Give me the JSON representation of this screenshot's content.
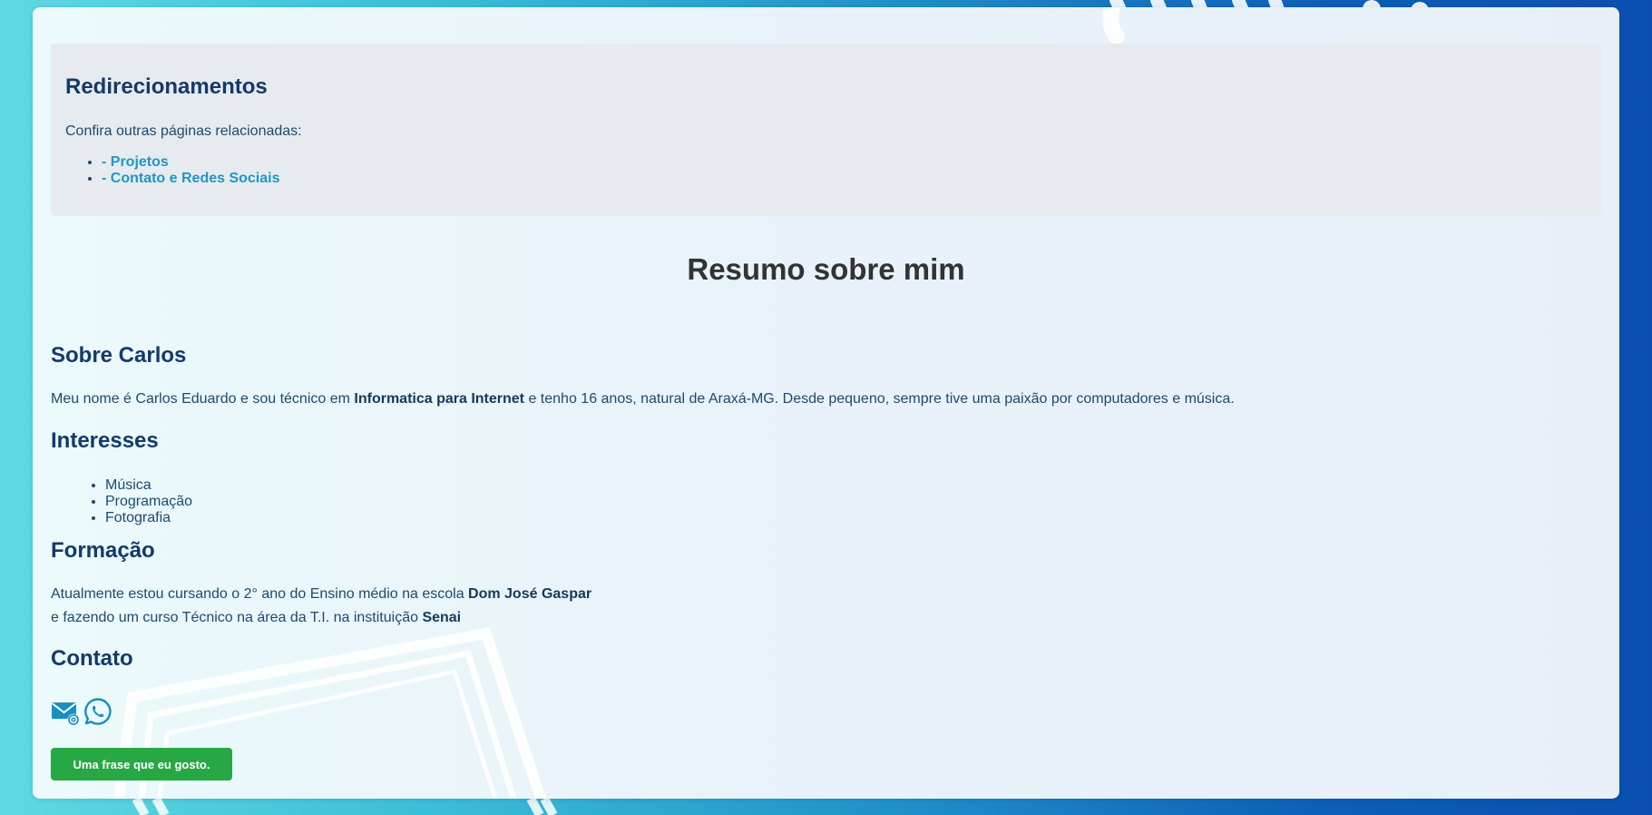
{
  "redirects": {
    "title": "Redirecionamentos",
    "intro": "Confira outras páginas relacionadas:",
    "links": [
      {
        "label": "- Projetos"
      },
      {
        "label": "- Contato e Redes Sociais"
      }
    ]
  },
  "page_title": "Resumo sobre mim",
  "about": {
    "heading": "Sobre Carlos",
    "text_before": "Meu nome é Carlos Eduardo e sou técnico em ",
    "text_bold": "Informatica para Internet",
    "text_after": " e tenho 16 anos, natural de Araxá-MG. Desde pequeno, sempre tive uma paixão por computadores e música."
  },
  "interests": {
    "heading": "Interesses",
    "items": [
      "Música",
      "Programação",
      "Fotografia"
    ]
  },
  "education": {
    "heading": "Formação",
    "line1_before": "Atualmente estou cursando o 2° ano do Ensino médio na escola ",
    "line1_bold": "Dom José Gaspar",
    "line2_before": "e fazendo um curso Técnico na área da T.I. na instituição ",
    "line2_bold": "Senai"
  },
  "contact": {
    "heading": "Contato",
    "icons": [
      "email-icon",
      "whatsapp-icon"
    ]
  },
  "quote_button": {
    "label": "Uma frase que eu gosto."
  },
  "colors": {
    "heading": "#143a6a",
    "link": "#2196c6",
    "button": "#28a745",
    "icon": "#1a8fbf"
  }
}
